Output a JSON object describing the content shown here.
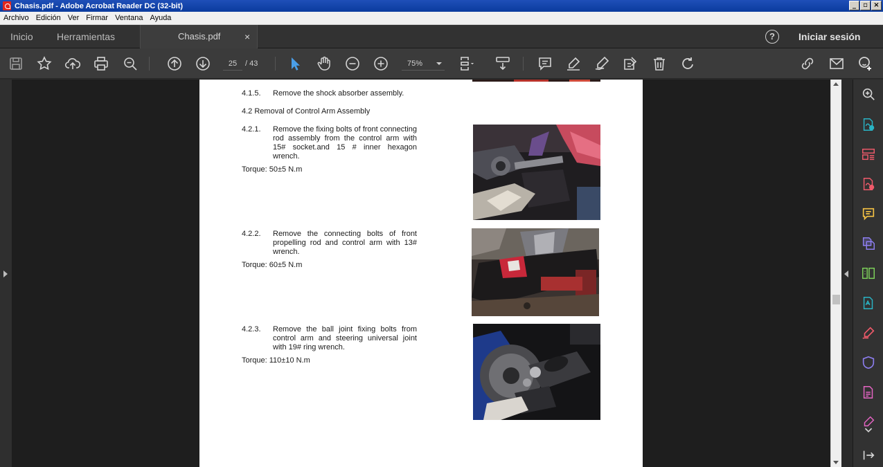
{
  "window": {
    "title": "Chasis.pdf - Adobe Acrobat Reader DC (32-bit)",
    "controls": [
      "_",
      "▫",
      "×"
    ]
  },
  "menu": [
    "Archivo",
    "Edición",
    "Ver",
    "Firmar",
    "Ventana",
    "Ayuda"
  ],
  "tabs": {
    "home": "Inicio",
    "tools": "Herramientas",
    "document": "Chasis.pdf",
    "close": "×"
  },
  "header": {
    "help": "?",
    "signin": "Iniciar sesión"
  },
  "toolbar": {
    "page_current": "25",
    "page_total": "/  43",
    "zoom": "75%"
  },
  "icons": {
    "toolbar": [
      "save-icon",
      "star-icon",
      "upload-cloud-icon",
      "print-icon",
      "zoom-search-icon",
      "page-up-icon",
      "page-down-icon",
      "select-arrow-icon",
      "hand-icon",
      "zoom-out-icon",
      "zoom-in-icon",
      "fit-page-icon",
      "scroll-mode-icon",
      "comment-icon",
      "highlight-pen-icon",
      "draw-icon",
      "stamp-icon",
      "trash-icon",
      "rotate-icon",
      "share-link-icon",
      "mail-icon",
      "add-user-icon"
    ],
    "right_panel": [
      "zoom-panel-icon",
      "export-pdf-icon",
      "organize-pages-icon",
      "create-pdf-icon",
      "comment-panel-icon",
      "combine-files-icon",
      "compress-icon",
      "edit-pdf-icon",
      "fill-sign-icon",
      "protect-icon",
      "send-for-review-icon",
      "more-tools-icon",
      "collapse-panel-icon",
      "exit-panel-icon"
    ]
  },
  "document": {
    "items": [
      {
        "num": "4.1.5.",
        "text": "Remove the shock absorber assembly."
      },
      {
        "heading": "4.2  Removal of Control Arm Assembly"
      },
      {
        "num": "4.2.1.",
        "text": "Remove the fixing bolts of front connecting rod assembly from the control arm with 15# socket.and 15 # inner hexagon wrench.",
        "torque": "Torque: 50±5 N.m"
      },
      {
        "num": "4.2.2.",
        "text": "Remove the connecting bolts of front propelling rod and control arm with 13# wrench.",
        "torque": "Torque: 60±5 N.m"
      },
      {
        "num": "4.2.3.",
        "text": "Remove the ball joint fixing bolts from control arm and steering universal joint with 19# ring wrench.",
        "torque": "Torque: 110±10 N.m"
      }
    ]
  },
  "colors": {
    "accent_blue": "#4a9fe8",
    "panel_teal": "#29b3c4",
    "panel_red": "#ee5a6a",
    "panel_yellow": "#f6c344",
    "panel_purple": "#8d7ef0",
    "panel_green": "#7dd15a",
    "panel_pink": "#e665c4"
  }
}
